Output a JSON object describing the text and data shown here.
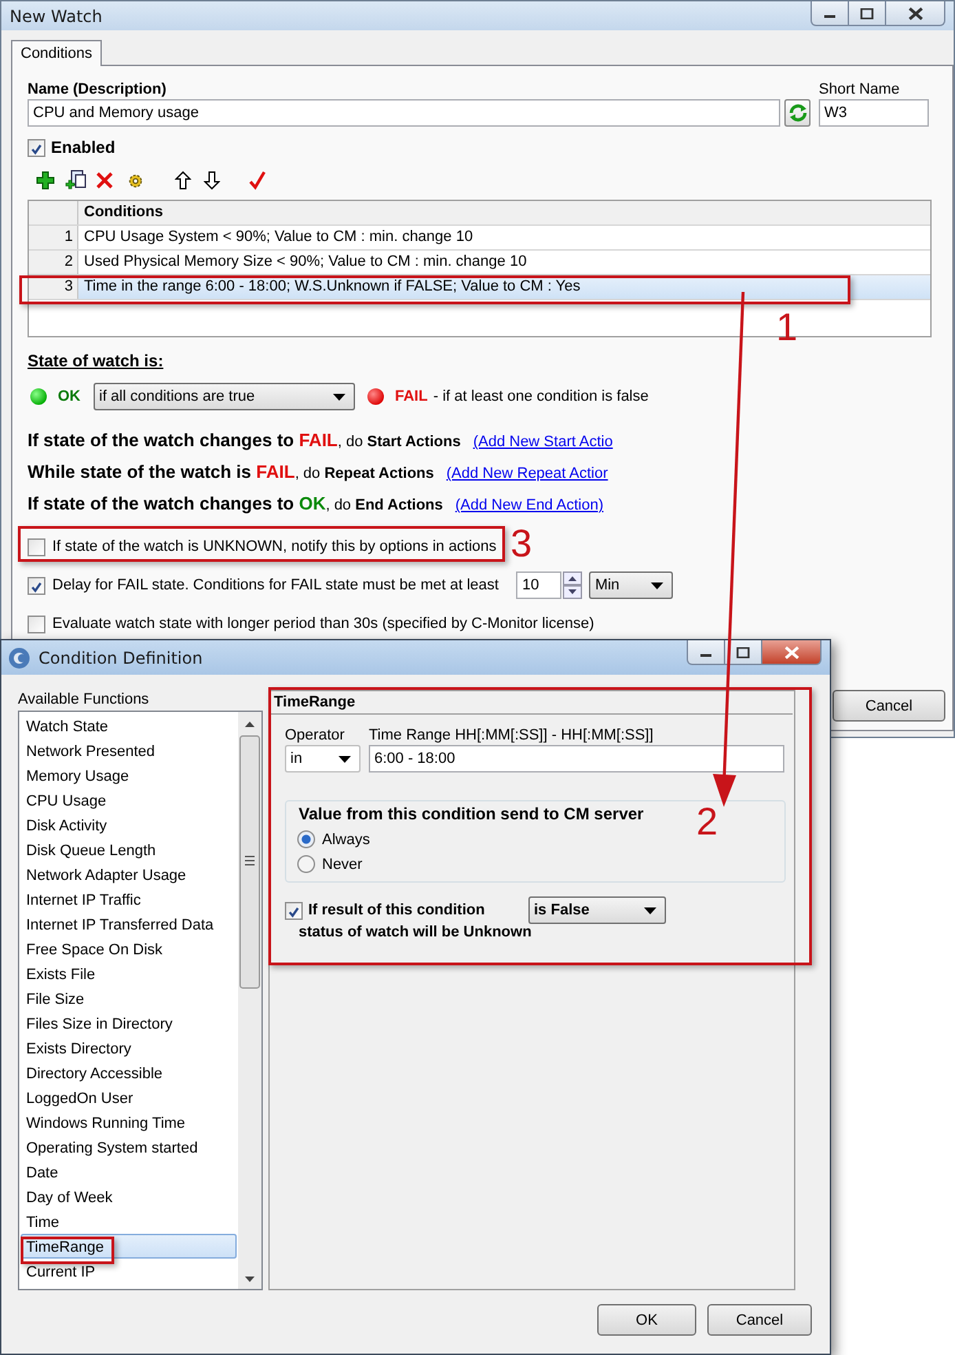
{
  "main_window": {
    "title": "New Watch",
    "tabs": [
      {
        "label": "Conditions",
        "selected": true
      }
    ],
    "name_label": "Name (Description)",
    "name_value": "CPU and Memory usage",
    "short_name_label": "Short Name",
    "short_name_value": "W3",
    "enabled": {
      "label": "Enabled",
      "checked": true
    },
    "conditions_table": {
      "columns": [
        "Conditions"
      ],
      "rows": [
        {
          "number": "1",
          "text": "CPU Usage System < 90%; Value to CM : min. change 10",
          "selected": false
        },
        {
          "number": "2",
          "text": "Used Physical Memory Size < 90%; Value to CM : min. change 10",
          "selected": false
        },
        {
          "number": "3",
          "text": "Time in the range 6:00 - 18:00; W.S.Unknown if FALSE; Value to CM : Yes",
          "selected": true
        }
      ]
    },
    "state_heading": "State of watch is:",
    "ok_label": "OK",
    "ok_condition": "if all conditions are true",
    "fail_label": "FAIL",
    "fail_description": "- if at least one condition is false",
    "action_rules": [
      {
        "lead": "If state of the watch changes to",
        "state": "FAIL",
        "color": "#e01010",
        "connector": ", do",
        "action": "Start Actions",
        "link": "(Add New Start Actio"
      },
      {
        "lead": "While state of the watch is",
        "state": "FAIL",
        "color": "#e01010",
        "connector": ", do",
        "action": "Repeat Actions",
        "link": "(Add New Repeat Actior"
      },
      {
        "lead": "If state of the watch changes to",
        "state": "OK",
        "color": "#0a8a0a",
        "connector": ", do",
        "action": "End Actions",
        "link": "(Add New End Action)"
      }
    ],
    "options": [
      {
        "kind": "check",
        "label": "If state of the watch is UNKNOWN, notify this by options in actions",
        "checked": false
      },
      {
        "kind": "delay",
        "label": "Delay for FAIL state. Conditions for FAIL state must be met at least",
        "checked": true,
        "value": "10",
        "unit": "Min"
      },
      {
        "kind": "check",
        "label": "Evaluate watch state with longer period than 30s (specified by C-Monitor license)",
        "checked": false
      }
    ],
    "buttons": [
      {
        "label": "Cancel"
      }
    ]
  },
  "dialog": {
    "title": "Condition Definition",
    "functions_label": "Available Functions",
    "functions": [
      {
        "label": "Watch State",
        "selected": false
      },
      {
        "label": "Network Presented",
        "selected": false
      },
      {
        "label": "Memory Usage",
        "selected": false
      },
      {
        "label": "CPU Usage",
        "selected": false
      },
      {
        "label": "Disk Activity",
        "selected": false
      },
      {
        "label": "Disk Queue Length",
        "selected": false
      },
      {
        "label": "Network Adapter Usage",
        "selected": false
      },
      {
        "label": "Internet IP Traffic",
        "selected": false
      },
      {
        "label": "Internet IP Transferred Data",
        "selected": false
      },
      {
        "label": "Free Space On Disk",
        "selected": false
      },
      {
        "label": "Exists File",
        "selected": false
      },
      {
        "label": "File Size",
        "selected": false
      },
      {
        "label": "Files Size in Directory",
        "selected": false
      },
      {
        "label": "Exists Directory",
        "selected": false
      },
      {
        "label": "Directory Accessible",
        "selected": false
      },
      {
        "label": "LoggedOn User",
        "selected": false
      },
      {
        "label": "Windows Running Time",
        "selected": false
      },
      {
        "label": "Operating System started",
        "selected": false
      },
      {
        "label": "Date",
        "selected": false
      },
      {
        "label": "Day of Week",
        "selected": false
      },
      {
        "label": "Time",
        "selected": false
      },
      {
        "label": "TimeRange",
        "selected": true
      },
      {
        "label": "Current IP",
        "selected": false
      }
    ],
    "panel_title": "TimeRange",
    "operator_label": "Operator",
    "operator_value": "in",
    "range_label": "Time Range HH[:MM[:SS]] - HH[:MM[:SS]]",
    "range_value": "6:00 - 18:00",
    "send_group": {
      "title": "Value from this condition send to CM server",
      "options": [
        {
          "label": "Always",
          "selected": true
        },
        {
          "label": "Never",
          "selected": false
        }
      ]
    },
    "unknown_rule": {
      "checked": true,
      "label": "If result of this condition",
      "value": "is False",
      "label_2": "status of watch will be Unknown"
    },
    "buttons": [
      {
        "label": "OK"
      },
      {
        "label": "Cancel"
      }
    ]
  },
  "callouts": [
    {
      "label": "1"
    },
    {
      "label": "2"
    },
    {
      "label": "3"
    }
  ]
}
